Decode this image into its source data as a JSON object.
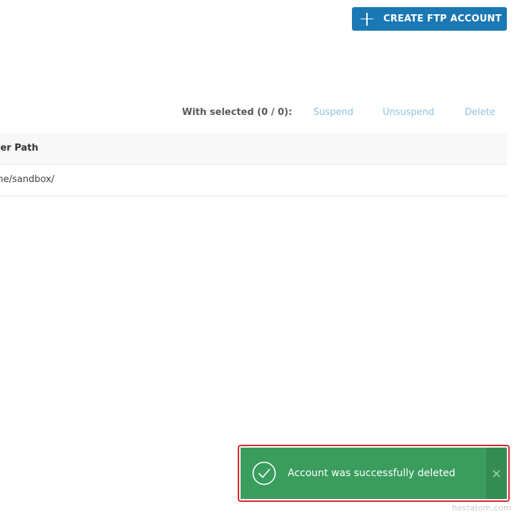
{
  "toolbar": {
    "create_label": "CREATE FTP ACCOUNT"
  },
  "bulk": {
    "label": "With selected (0 / 0):",
    "actions": {
      "suspend": "Suspend",
      "unsuspend": "Unsuspend",
      "delete": "Delete"
    }
  },
  "table": {
    "columns": [
      "ver Path"
    ],
    "rows": [
      {
        "path": "me/sandbox/"
      }
    ]
  },
  "toast": {
    "message": "Account was successfully deleted",
    "type": "success"
  },
  "watermark": "hostatom.com",
  "colors": {
    "primary": "#1a78b4",
    "success": "#3a9d5d",
    "link_disabled": "#8fc2e0",
    "highlight": "#d9262c"
  },
  "icons": {
    "create": "plus-icon",
    "toast": "check-circle-icon",
    "close": "close-icon"
  }
}
